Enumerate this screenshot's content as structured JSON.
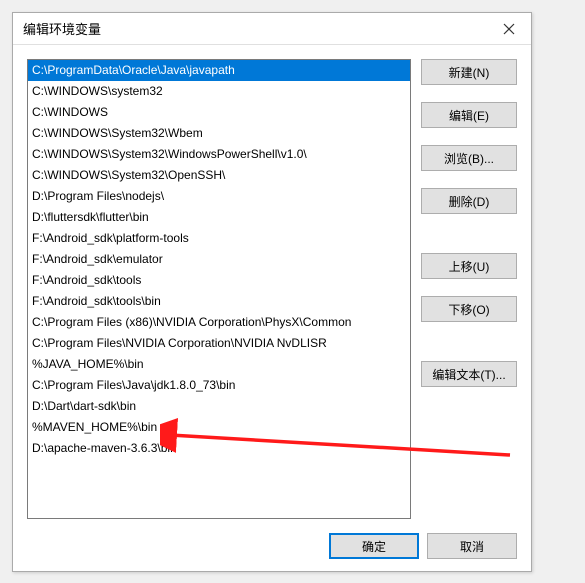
{
  "dialog": {
    "title": "编辑环境变量"
  },
  "list": {
    "items": [
      "C:\\ProgramData\\Oracle\\Java\\javapath",
      "C:\\WINDOWS\\system32",
      "C:\\WINDOWS",
      "C:\\WINDOWS\\System32\\Wbem",
      "C:\\WINDOWS\\System32\\WindowsPowerShell\\v1.0\\",
      "C:\\WINDOWS\\System32\\OpenSSH\\",
      "D:\\Program Files\\nodejs\\",
      "D:\\fluttersdk\\flutter\\bin",
      "F:\\Android_sdk\\platform-tools",
      "F:\\Android_sdk\\emulator",
      "F:\\Android_sdk\\tools",
      "F:\\Android_sdk\\tools\\bin",
      "C:\\Program Files (x86)\\NVIDIA Corporation\\PhysX\\Common",
      "C:\\Program Files\\NVIDIA Corporation\\NVIDIA NvDLISR",
      "%JAVA_HOME%\\bin",
      "C:\\Program Files\\Java\\jdk1.8.0_73\\bin",
      "D:\\Dart\\dart-sdk\\bin",
      "%MAVEN_HOME%\\bin",
      "D:\\apache-maven-3.6.3\\bin"
    ],
    "selected_index": 0
  },
  "buttons": {
    "new": "新建(N)",
    "edit": "编辑(E)",
    "browse": "浏览(B)...",
    "delete": "删除(D)",
    "move_up": "上移(U)",
    "move_down": "下移(O)",
    "edit_text": "编辑文本(T)...",
    "ok": "确定",
    "cancel": "取消"
  }
}
